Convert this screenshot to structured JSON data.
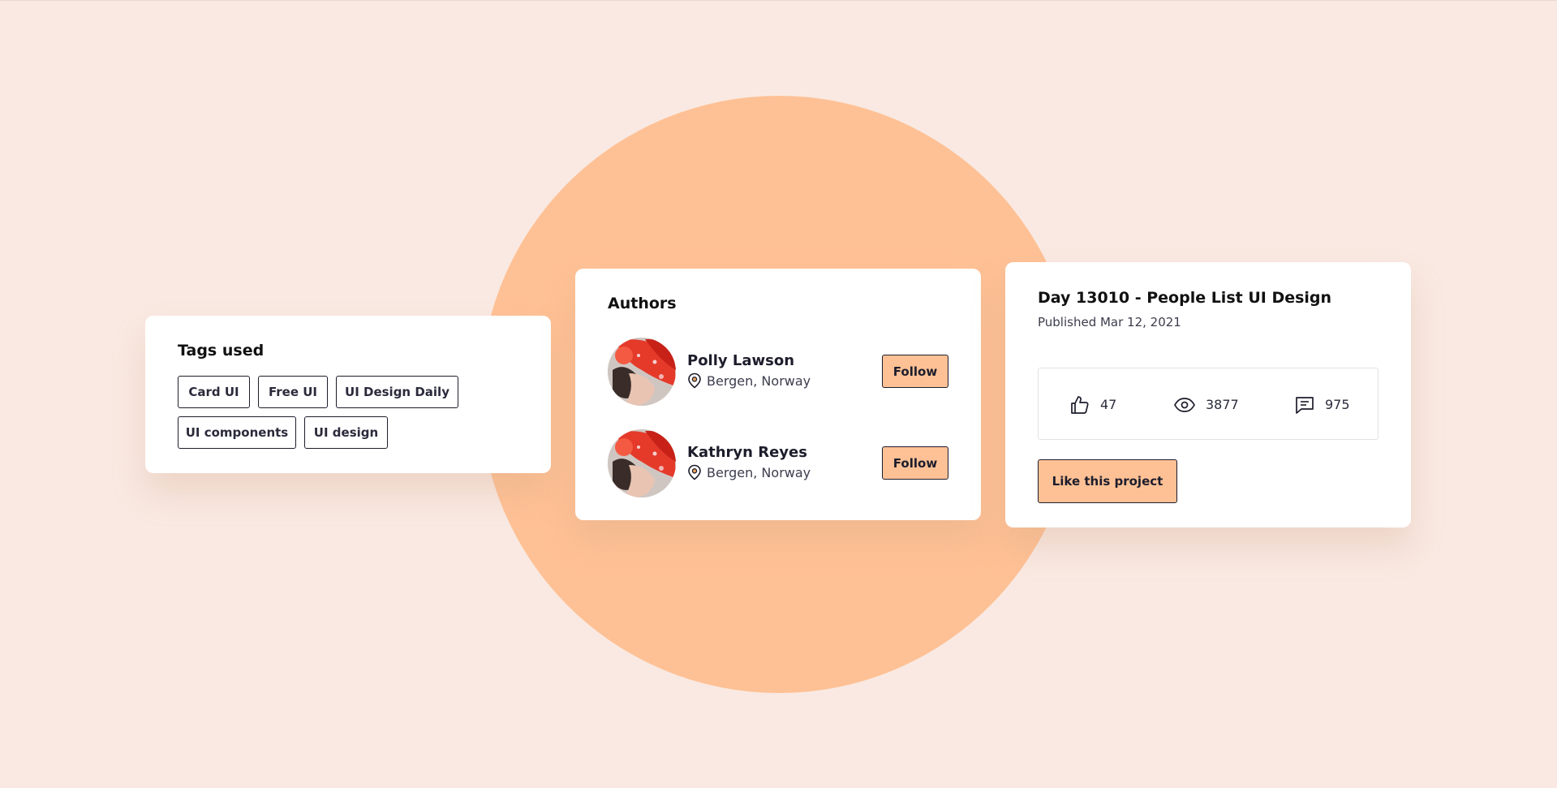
{
  "tags_card": {
    "title": "Tags used",
    "tags": [
      "Card UI",
      "Free UI",
      "UI Design Daily",
      "UI components",
      "UI design"
    ]
  },
  "authors_card": {
    "title": "Authors",
    "authors": [
      {
        "name": "Polly Lawson",
        "location": "Bergen, Norway",
        "follow_label": "Follow"
      },
      {
        "name": "Kathryn Reyes",
        "location": "Bergen, Norway",
        "follow_label": "Follow"
      }
    ]
  },
  "project_card": {
    "title": "Day 13010 - People List UI Design",
    "published": "Published Mar 12, 2021",
    "stats": {
      "likes": "47",
      "views": "3877",
      "comments": "975"
    },
    "like_button_label": "Like this project"
  },
  "icons": {
    "location": "map-pin-icon",
    "likes": "thumbs-up-icon",
    "views": "eye-icon",
    "comments": "comment-icon"
  },
  "colors": {
    "background": "#f9e9e2",
    "accent": "#fec195",
    "text": "#1d1d2c",
    "card": "#ffffff",
    "pin_accent": "#f0a35e"
  }
}
